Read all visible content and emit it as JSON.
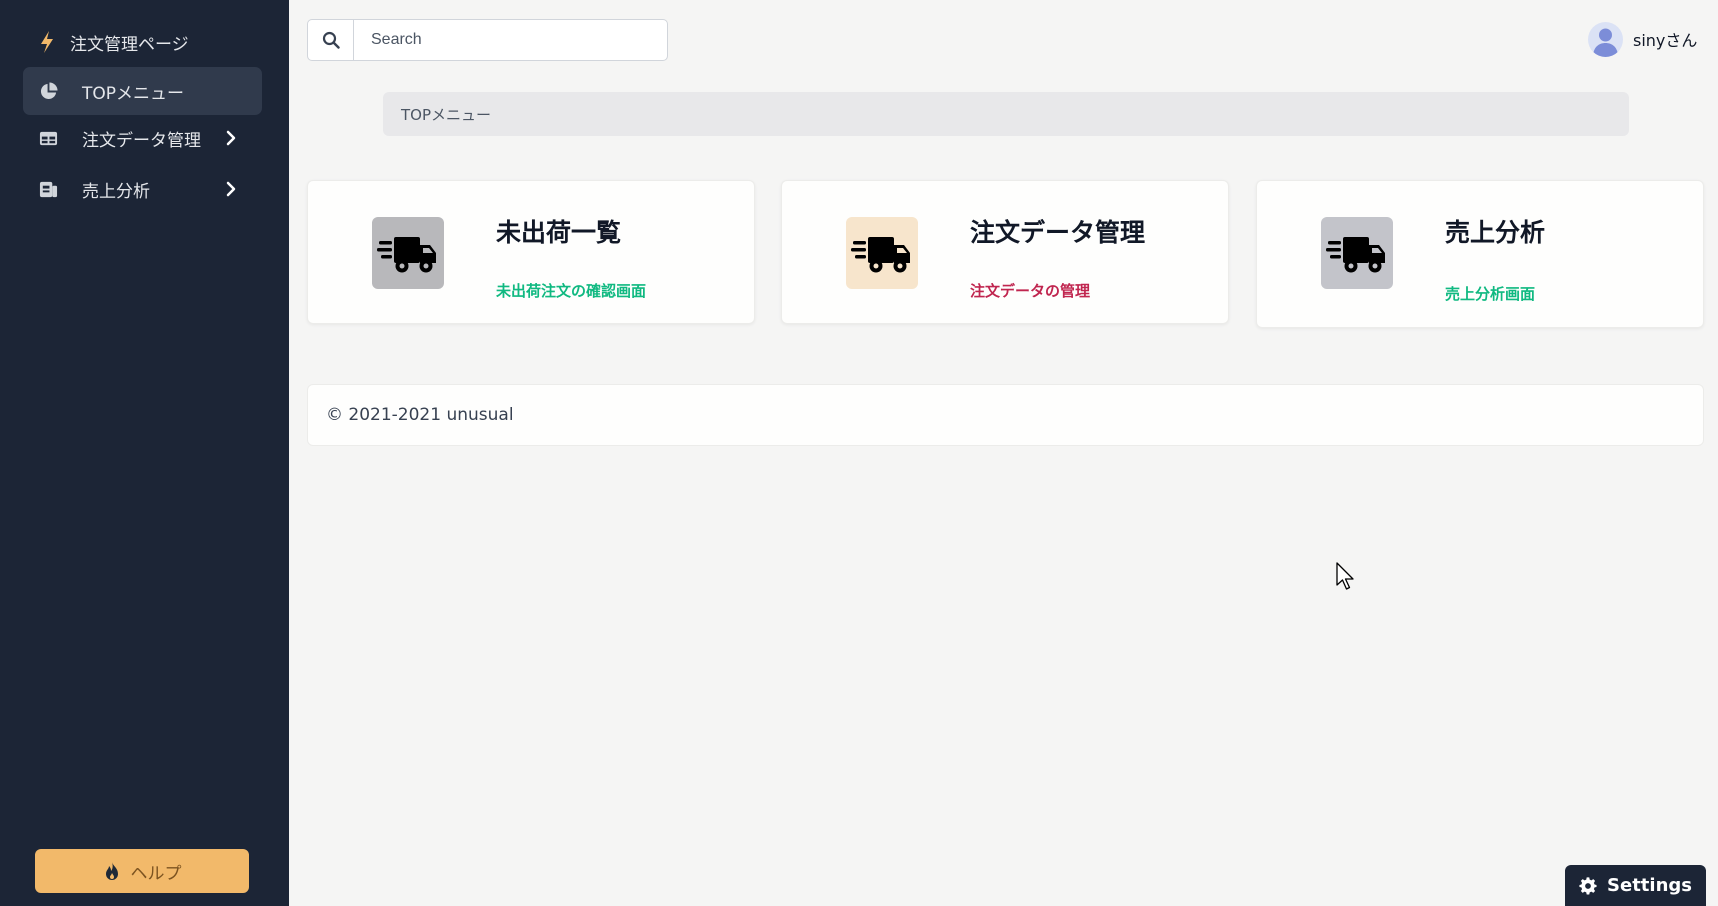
{
  "sidebar": {
    "brand": "注文管理ページ",
    "items": [
      {
        "label": "TOPメニュー",
        "icon": "pie-chart-icon",
        "active": true
      },
      {
        "label": "注文データ管理",
        "icon": "table-icon",
        "active": false
      },
      {
        "label": "売上分析",
        "icon": "report-icon",
        "active": false
      }
    ],
    "help_label": "ヘルプ"
  },
  "search": {
    "placeholder": "Search"
  },
  "user": {
    "name": "sinyさん"
  },
  "breadcrumb": "TOPメニュー",
  "cards": [
    {
      "title": "未出荷一覧",
      "subtitle": "未出荷注文の確認画面",
      "subtitle_color": "#10b981",
      "tile_color": "#b8b8bb"
    },
    {
      "title": "注文データ管理",
      "subtitle": "注文データの管理",
      "subtitle_color": "#c0254f",
      "tile_color": "#f7e5cc"
    },
    {
      "title": "売上分析",
      "subtitle": "売上分析画面",
      "subtitle_color": "#10b981",
      "tile_color": "#c3c4ca"
    }
  ],
  "footer": "© 2021-2021 unusual",
  "settings_label": "Settings",
  "colors": {
    "sidebar": "#1c2536",
    "help": "#f2b96a"
  }
}
